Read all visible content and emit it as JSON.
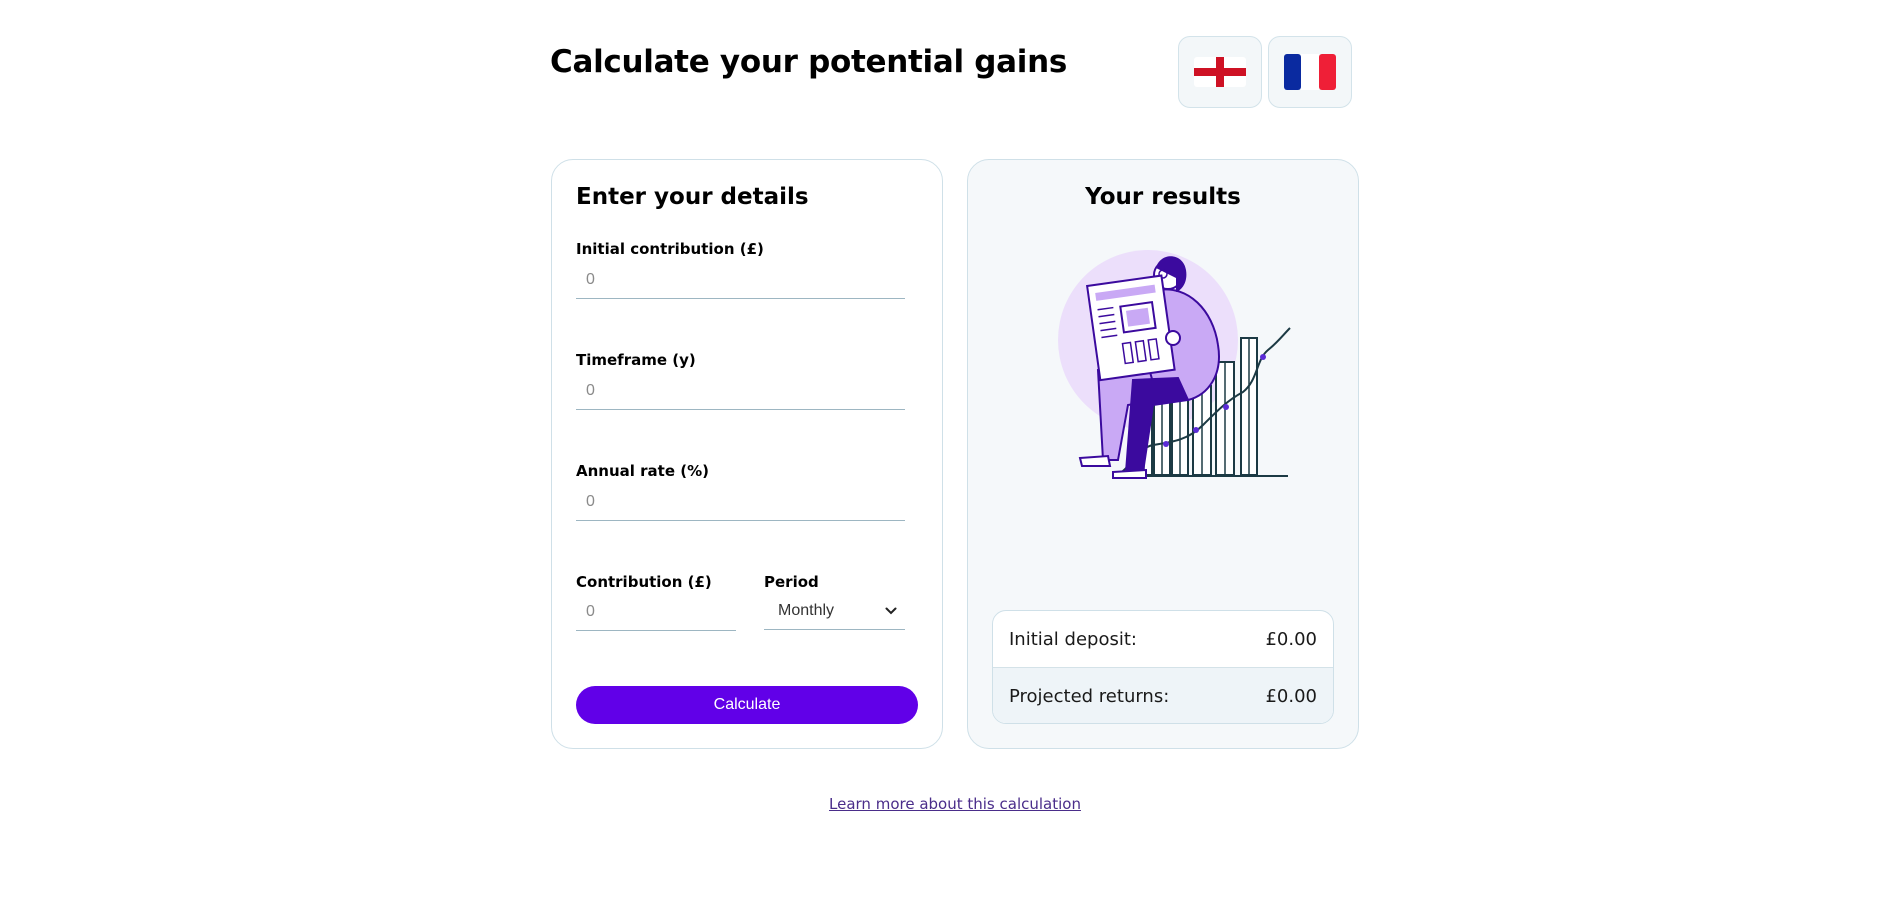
{
  "header": {
    "title": "Calculate your potential gains",
    "languages": [
      {
        "code": "en",
        "icon": "england-flag-icon"
      },
      {
        "code": "fr",
        "icon": "france-flag-icon"
      }
    ]
  },
  "form": {
    "heading": "Enter your details",
    "initial_contribution": {
      "label": "Initial contribution (£)",
      "placeholder": "0"
    },
    "timeframe": {
      "label": "Timeframe (y)",
      "placeholder": "0"
    },
    "annual_rate": {
      "label": "Annual rate (%)",
      "placeholder": "0"
    },
    "contribution": {
      "label": "Contribution (£)",
      "placeholder": "0"
    },
    "period": {
      "label": "Period",
      "selected": "Monthly"
    },
    "calculate_label": "Calculate"
  },
  "results": {
    "heading": "Your results",
    "rows": [
      {
        "label": "Initial deposit:",
        "value": "£0.00"
      },
      {
        "label": "Projected returns:",
        "value": "£0.00"
      }
    ]
  },
  "footer": {
    "learn_more": "Learn more about this calculation"
  },
  "colors": {
    "accent": "#6100e8",
    "illustration_purple": "#c9a9f5",
    "illustration_dark": "#3b0a9e",
    "link": "#4a2d8a"
  }
}
